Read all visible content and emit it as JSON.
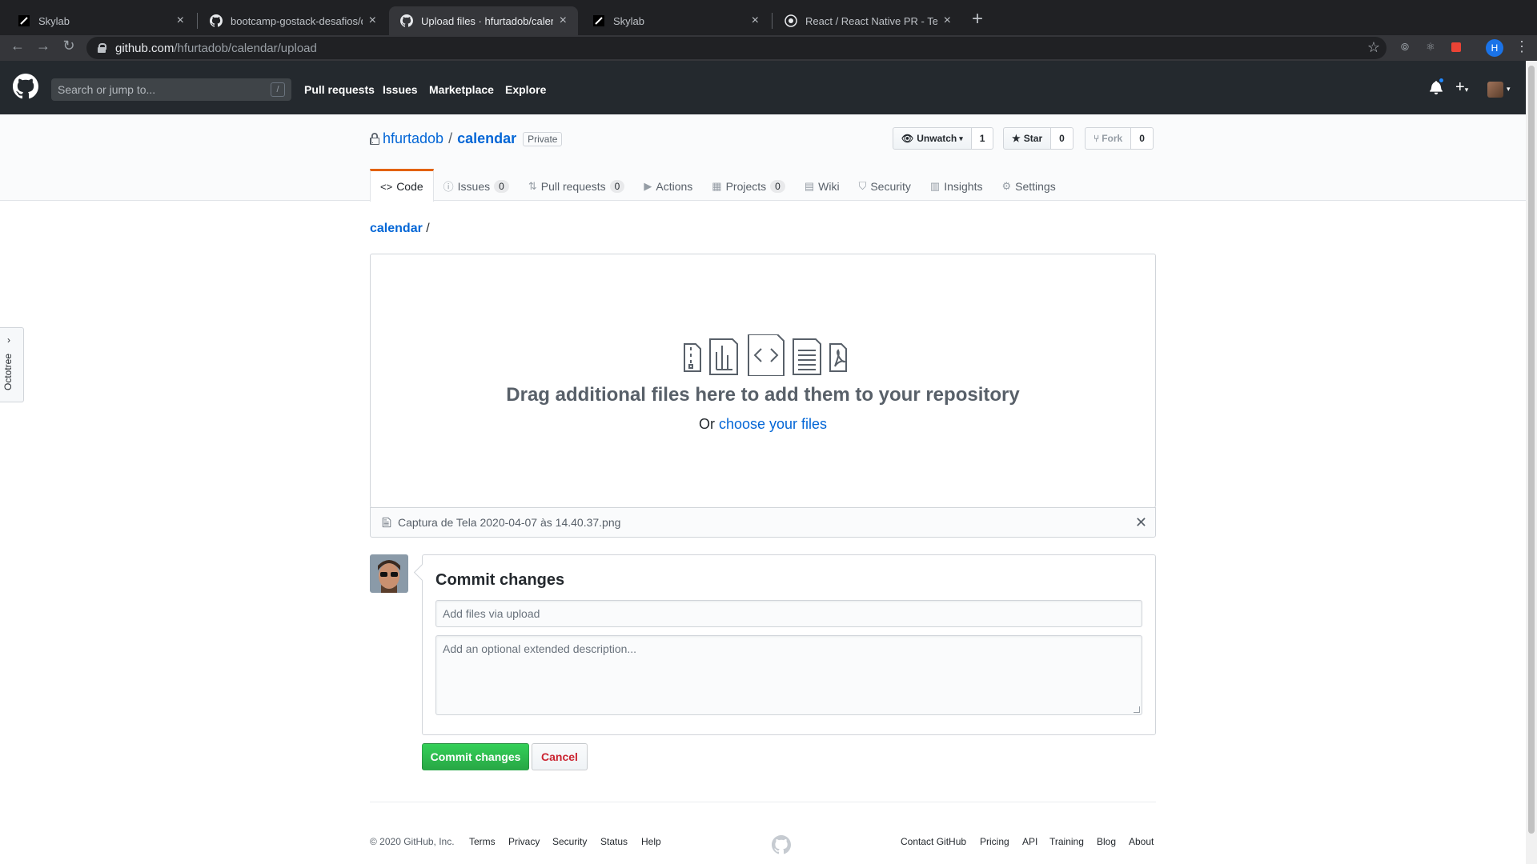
{
  "browser": {
    "tabs": [
      {
        "title": "Skylab",
        "favicon": "skylab-icon",
        "active": false
      },
      {
        "title": "bootcamp-gostack-desafios/de",
        "favicon": "github-icon",
        "active": false
      },
      {
        "title": "Upload files · hfurtadob/calendar",
        "favicon": "github-icon",
        "active": true
      },
      {
        "title": "Skylab",
        "favicon": "skylab-icon",
        "active": false
      },
      {
        "title": "React / React Native PR - Teamw",
        "favicon": "teamwork-icon",
        "active": false
      }
    ],
    "url_host": "github.com",
    "url_path": "/hfurtadob/calendar/upload",
    "profile_initial": "H"
  },
  "header": {
    "search_placeholder": "Search or jump to...",
    "search_shortcut": "/",
    "nav": [
      "Pull requests",
      "Issues",
      "Marketplace",
      "Explore"
    ]
  },
  "repo": {
    "owner": "hfurtadob",
    "name": "calendar",
    "visibility": "Private",
    "watch_label": "Unwatch",
    "watch_count": "1",
    "star_label": "Star",
    "star_count": "0",
    "fork_label": "Fork",
    "fork_count": "0",
    "tabs": [
      {
        "label": "Code",
        "icon": "code-icon",
        "count": null,
        "selected": true
      },
      {
        "label": "Issues",
        "icon": "issue-icon",
        "count": "0"
      },
      {
        "label": "Pull requests",
        "icon": "pull-request-icon",
        "count": "0"
      },
      {
        "label": "Actions",
        "icon": "play-icon",
        "count": null
      },
      {
        "label": "Projects",
        "icon": "project-icon",
        "count": "0"
      },
      {
        "label": "Wiki",
        "icon": "book-icon",
        "count": null
      },
      {
        "label": "Security",
        "icon": "shield-icon",
        "count": null
      },
      {
        "label": "Insights",
        "icon": "graph-icon",
        "count": null
      },
      {
        "label": "Settings",
        "icon": "gear-icon",
        "count": null
      }
    ]
  },
  "upload": {
    "breadcrumb_repo": "calendar",
    "breadcrumb_sep": "/",
    "drop_title": "Drag additional files here to add them to your repository",
    "drop_sub_prefix": "Or",
    "drop_sub_link": "choose your files",
    "file_name": "Captura de Tela 2020-04-07 às 14.40.37.png",
    "remove_label": "✕"
  },
  "commit": {
    "title": "Commit changes",
    "summary_placeholder": "Add files via upload",
    "description_placeholder": "Add an optional extended description...",
    "submit_label": "Commit changes",
    "cancel_label": "Cancel"
  },
  "footer": {
    "copyright": "© 2020 GitHub, Inc.",
    "left_links": [
      "Terms",
      "Privacy",
      "Security",
      "Status",
      "Help"
    ],
    "right_links": [
      "Contact GitHub",
      "Pricing",
      "API",
      "Training",
      "Blog",
      "About"
    ]
  },
  "octotree": {
    "label": "Octotree"
  },
  "colors": {
    "brand_header": "#24292e",
    "link": "#0366d6",
    "primary_green": "#28a745",
    "danger": "#cb2431",
    "selected_tab_accent": "#e36209"
  }
}
